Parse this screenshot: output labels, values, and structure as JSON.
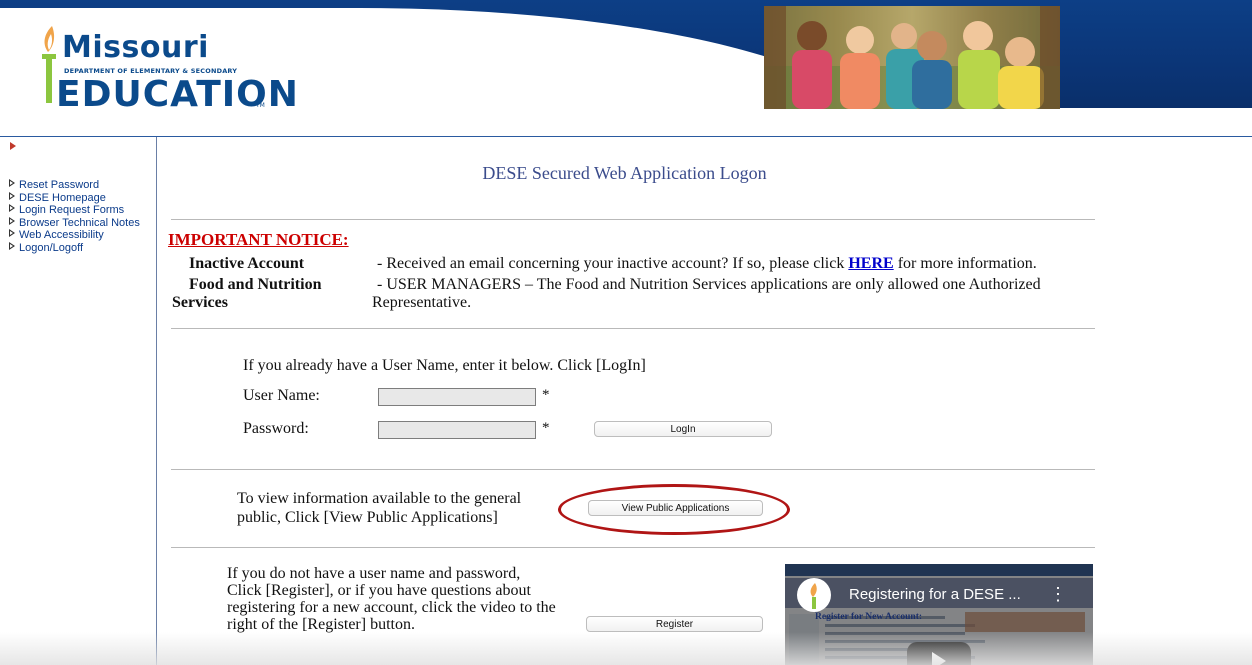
{
  "header": {
    "logo": {
      "state_name": "Missouri",
      "department": "DEPARTMENT OF ELEMENTARY & SECONDARY",
      "word": "EDUCATION",
      "trademark": "TM"
    },
    "photo_icon": "children-group-photo"
  },
  "sidebar": {
    "items": [
      {
        "label": "Reset Password"
      },
      {
        "label": "DESE Homepage"
      },
      {
        "label": "Login Request Forms"
      },
      {
        "label": "Browser Technical Notes"
      },
      {
        "label": "Web Accessibility"
      },
      {
        "label": "Logon/Logoff"
      }
    ]
  },
  "main": {
    "title": "DESE Secured Web Application Logon",
    "notice": {
      "heading": "IMPORTANT NOTICE:",
      "inactive_label": "Inactive Account",
      "inactive_text_before": "- Received an email concerning your inactive account? If so, please click",
      "inactive_link": "HERE",
      "inactive_text_after": "for more information.",
      "fns_label_line1": "Food and Nutrition",
      "fns_label_line2": "Services",
      "fns_text_line1": "- USER MANAGERS – The Food and Nutrition Services applications are only allowed one Authorized",
      "fns_text_line2": "Representative."
    },
    "login": {
      "instruction": "If you already have a User Name, enter it below. Click [LogIn]",
      "username_label": "User Name:",
      "username_value": "",
      "password_label": "Password:",
      "password_value": "",
      "required_mark": "*",
      "login_button": "LogIn"
    },
    "public": {
      "text_line1": "To view information available to the general",
      "text_line2": "public, Click [View Public Applications]",
      "button": "View Public Applications"
    },
    "register": {
      "text_line1": "If you do not have a user name and password,",
      "text_line2": "Click [Register], or if you have questions about",
      "text_line3": "registering for a new account, click the video to the",
      "text_line4": "right of the [Register] button.",
      "button": "Register"
    },
    "video": {
      "title": "Registering for a DESE ...",
      "menu": "⋮",
      "inner_heading": "Register for New Account:"
    }
  },
  "colors": {
    "header_blue": "#0b3577",
    "link_blue": "#0b3b8a",
    "notice_red": "#cc0000",
    "highlight_red": "#b01515",
    "title_blue": "#3b4c8c"
  }
}
